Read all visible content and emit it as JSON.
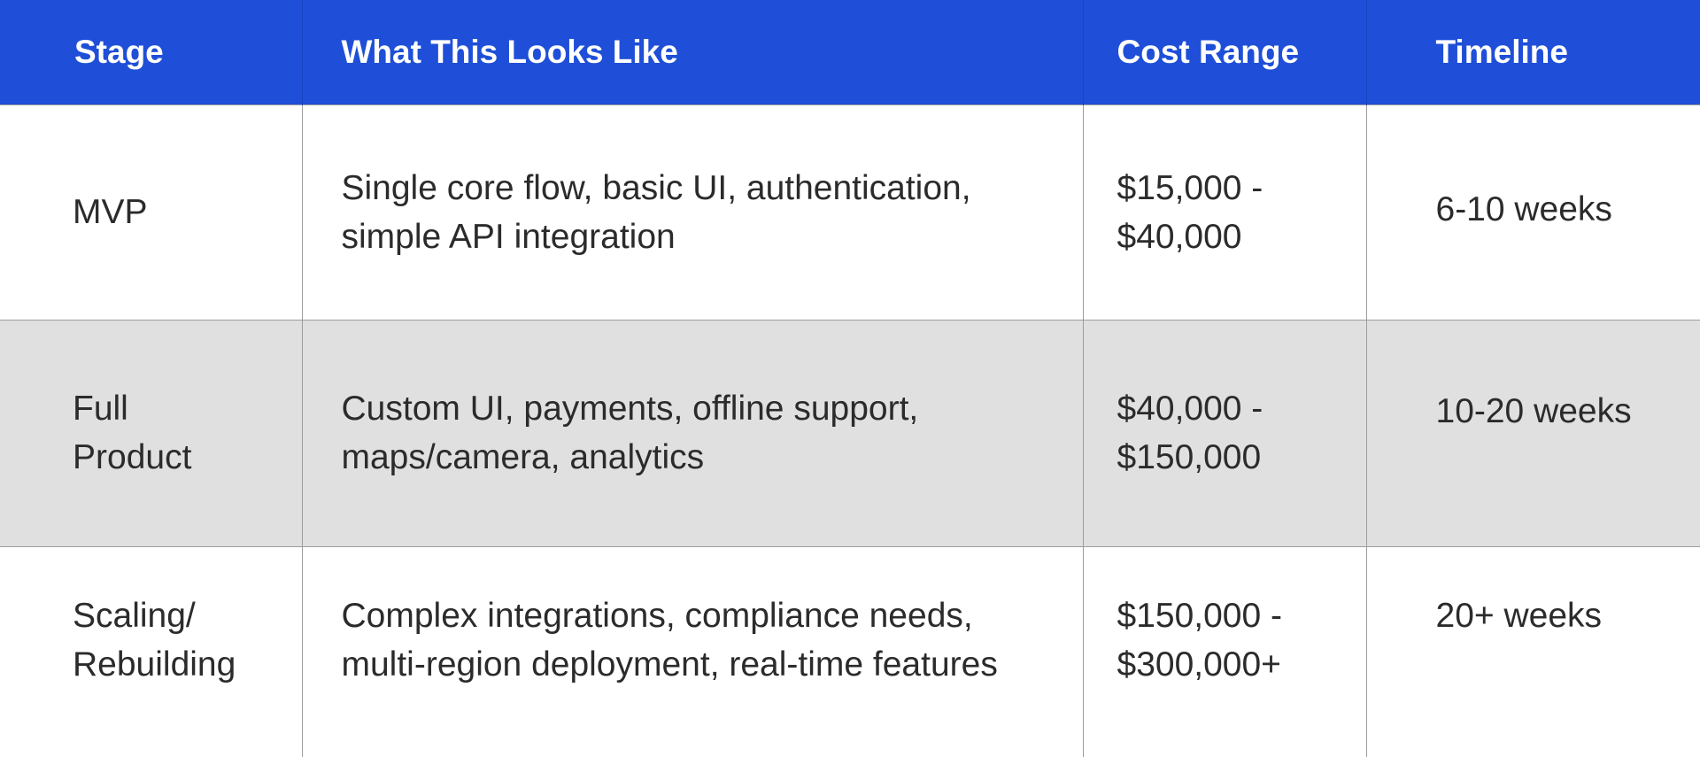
{
  "table": {
    "headers": [
      "Stage",
      "What This Looks Like",
      "Cost Range",
      "Timeline"
    ],
    "rows": [
      {
        "stage": "MVP",
        "description": "Single core flow, basic UI, authentication,\nsimple API integration",
        "cost": "$15,000 -\n$40,000",
        "timeline": "6-10 weeks"
      },
      {
        "stage": "Full\nProduct",
        "description": "Custom UI, payments, offline support,\nmaps/camera, analytics",
        "cost": "$40,000 -\n$150,000",
        "timeline": "10-20 weeks"
      },
      {
        "stage": "Scaling/\nRebuilding",
        "description": "Complex integrations, compliance needs,\nmulti-region deployment, real-time features",
        "cost": "$150,000 -\n $300,000+",
        "timeline": "20+ weeks"
      }
    ]
  },
  "colors": {
    "header_background": "#1f4fd8",
    "header_text": "#ffffff",
    "body_text": "#2b2b2b",
    "striped_row": "#e0e0e0",
    "grid_line": "#9d9d9d"
  }
}
